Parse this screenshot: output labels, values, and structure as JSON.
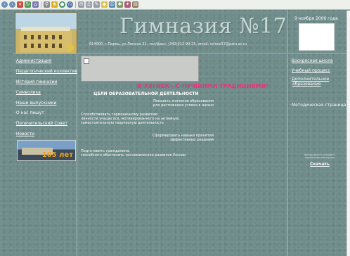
{
  "toolbar": {
    "icons": [
      "back-icon",
      "forward-icon",
      "stop-icon",
      "refresh-icon",
      "home-icon",
      "search-icon",
      "favorites-icon",
      "media-icon",
      "history-icon",
      "mail-icon",
      "print-icon",
      "edit-icon",
      "discuss-icon",
      "messenger-icon",
      "tools-icon",
      "star-icon",
      "folder-icon"
    ]
  },
  "header": {
    "title": "Гимназия №17",
    "address": "614000, г.Пермь, ул.Ленина 31, тел/факс: (342)212-99-25, email: school17@pstu.ac.ru",
    "date": "9 ноября 2006 года"
  },
  "left_nav": [
    {
      "label": "Администрация"
    },
    {
      "label": "Педагогический коллектив"
    },
    {
      "label": "История гимназии"
    },
    {
      "label": "Символика"
    },
    {
      "label": "Наши выпускники"
    },
    {
      "label": "О нас пишут"
    },
    {
      "label": "Попечительский Совет"
    },
    {
      "label": "Новости"
    }
  ],
  "photo_label": "105 лет",
  "main": {
    "motto": "В XXI ВЕК - С ЛУЧШИМИ ТРАДИЦИЯМИ!",
    "goals_title": "ЦЕЛИ ОБРАЗОВАТЕЛЬНОЙ ДЕЯТЕЛЬНОСТИ",
    "goal1_line1": "Показать значение образования",
    "goal1_line2": "для достижения успеха в жизни",
    "goal2_line1": "Способствовать гармоничному развитию",
    "goal2_line2": "личности учащегося, мотивированного на активную",
    "goal2_line3": "самостоятельную творческую деятельность",
    "goal3_line1": "Сформировать навыки принятия",
    "goal3_line2": "эффективных решений",
    "goal4_line1": "Подготовить гражданина,",
    "goal4_line2": "способного обеспечить экономическое развитие России"
  },
  "right_nav": [
    {
      "label": "Воскресная школа"
    },
    {
      "label": "Учебный процесс"
    },
    {
      "label": "Дополнительное"
    },
    {
      "label": "образование"
    }
  ],
  "right_static": "Методическая страница",
  "download": {
    "note_line1": "Рекомендуется установить",
    "note_line2": "виртуальную машину Java",
    "link": "Скачать"
  }
}
